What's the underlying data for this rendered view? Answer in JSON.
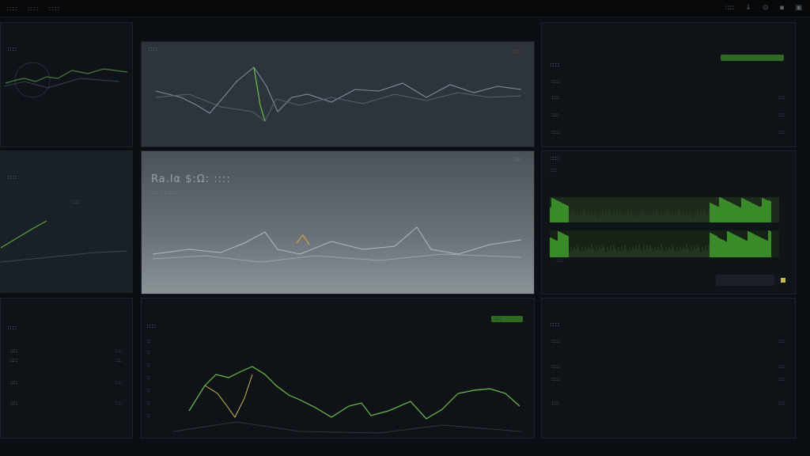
{
  "topbar": {
    "menu": [
      "::::",
      "::::",
      "::::"
    ],
    "right": [
      "::::",
      "↓",
      "⊙",
      "▪",
      "▣"
    ]
  },
  "left_top": {
    "title": "::::"
  },
  "left_mid": {
    "title": "::::",
    "meta": "::::"
  },
  "left_bottom": {
    "title": "::::",
    "rows": [
      {
        "name": "::::",
        "val": "::::"
      },
      {
        "name": "::::",
        "val": "::::"
      },
      {
        "name": "::::",
        "val": "::::"
      },
      {
        "name": "::::",
        "val": "::::"
      }
    ]
  },
  "center_top": {
    "title": "::::",
    "meta": "::::"
  },
  "center_mid": {
    "title": "Ra.lα $:Ω: ::::",
    "sub": ":::: :::: ::::",
    "meta": "::::"
  },
  "center_bottom": {
    "title": "::::",
    "meta": "::::",
    "axis": [
      "::",
      "::",
      "::",
      "::",
      "::",
      "::",
      "::"
    ]
  },
  "right_top": {
    "title": "::::",
    "rows": [
      {
        "name": "::::",
        "val": ""
      },
      {
        "name": "::::",
        "val": "::::"
      },
      {
        "name": "::::",
        "val": "::::"
      },
      {
        "name": "::::",
        "val": "::::"
      }
    ]
  },
  "right_mid": {
    "title": "::::",
    "sub": "::::",
    "footer": "::::"
  },
  "right_bottom": {
    "title": "::::",
    "rows": [
      {
        "name": "::::",
        "val": "::::"
      },
      {
        "name": "::::",
        "val": "::::"
      },
      {
        "name": "::::",
        "val": "::::"
      },
      {
        "name": "::::",
        "val": "::::"
      }
    ]
  },
  "colors": {
    "accent": "#6ac04a",
    "background": "#0b0e12",
    "panel": "#131820"
  }
}
